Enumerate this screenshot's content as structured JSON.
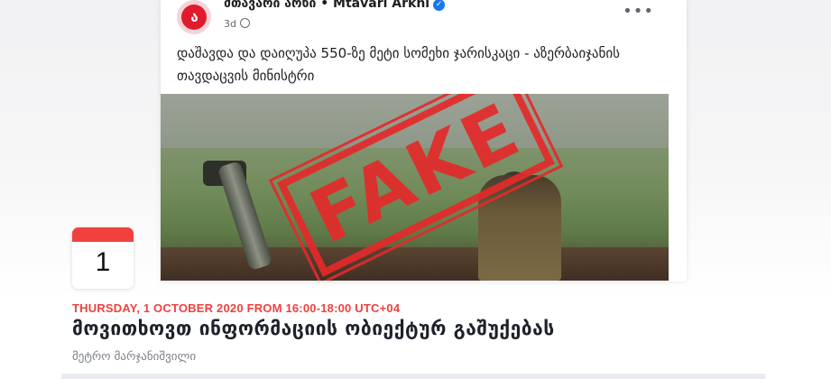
{
  "post": {
    "page_name": "მთავარი არხი • Mtavari Arkhi",
    "logo_text": "ა",
    "time": "3d",
    "more_label": "•••",
    "text": "დაშავდა და დაიღუპა 550-ზე მეტი სომეხი ჯარისკაცი - აზერბაიჯანის თავდაცვის მინისტრი",
    "stamp_text": "FAKE"
  },
  "event": {
    "calendar_day": "1",
    "date": "THURSDAY, 1 OCTOBER 2020 FROM 16:00-18:00 UTC+04",
    "title": "მოვითხოვთ ინფორმაციის ობიექტურ გაშუქებას",
    "host": "მეტრო მარჯანიშვილი"
  },
  "colors": {
    "accent_red": "#f0413f",
    "stamp_red": "#e42a2a",
    "facebook_blue": "#1877f2"
  },
  "icons": [
    "verified-badge-icon",
    "globe-icon",
    "more-options-icon",
    "calendar-icon"
  ]
}
